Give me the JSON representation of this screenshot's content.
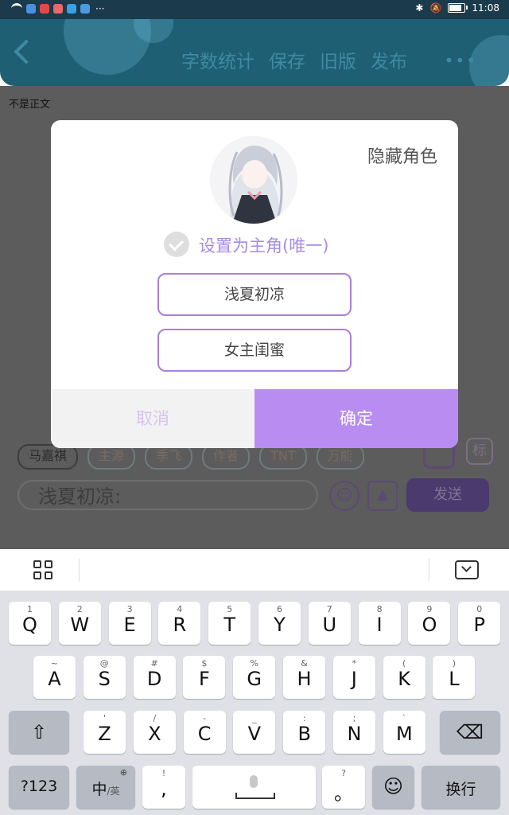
{
  "status_bar": {
    "time": "11:08",
    "more": "···"
  },
  "header": {
    "actions": [
      "字数统计",
      "保存",
      "旧版",
      "发布"
    ],
    "more": "•••"
  },
  "note": "不是正文",
  "bottom_bar": {
    "chips": [
      "马嘉祺",
      "主源",
      "季飞",
      "作者",
      "TNT",
      "万能"
    ],
    "tag_icon": "标",
    "compose_value": "浅夏初凉:",
    "send": "发送"
  },
  "dialog": {
    "hide_role": "隐藏角色",
    "set_main": "设置为主角(唯一)",
    "roles": [
      "浅夏初凉",
      "女主闺蜜"
    ],
    "cancel": "取消",
    "confirm": "确定"
  },
  "keyboard": {
    "row1": [
      [
        "1",
        "Q"
      ],
      [
        "2",
        "W"
      ],
      [
        "3",
        "E"
      ],
      [
        "4",
        "R"
      ],
      [
        "5",
        "T"
      ],
      [
        "6",
        "Y"
      ],
      [
        "7",
        "U"
      ],
      [
        "8",
        "I"
      ],
      [
        "9",
        "O"
      ],
      [
        "0",
        "P"
      ]
    ],
    "row2": [
      [
        "~",
        "A"
      ],
      [
        "@",
        "S"
      ],
      [
        "#",
        "D"
      ],
      [
        "$",
        "F"
      ],
      [
        "%",
        "G"
      ],
      [
        "&",
        "H"
      ],
      [
        "*",
        "J"
      ],
      [
        "(",
        "K"
      ],
      [
        ")",
        "L"
      ]
    ],
    "row3": [
      [
        "'",
        "Z"
      ],
      [
        "/",
        "X"
      ],
      [
        "-",
        "C"
      ],
      [
        "_",
        "V"
      ],
      [
        ":",
        "B"
      ],
      [
        ";",
        "N"
      ],
      [
        "`",
        "M"
      ]
    ],
    "symbols_key": "?123",
    "lang_key": "中",
    "lang_alt": "/英",
    "punct_top": "!",
    "punct_main": ",",
    "punct2_top": "?",
    "punct2_main": "。",
    "enter_key": "换行"
  }
}
